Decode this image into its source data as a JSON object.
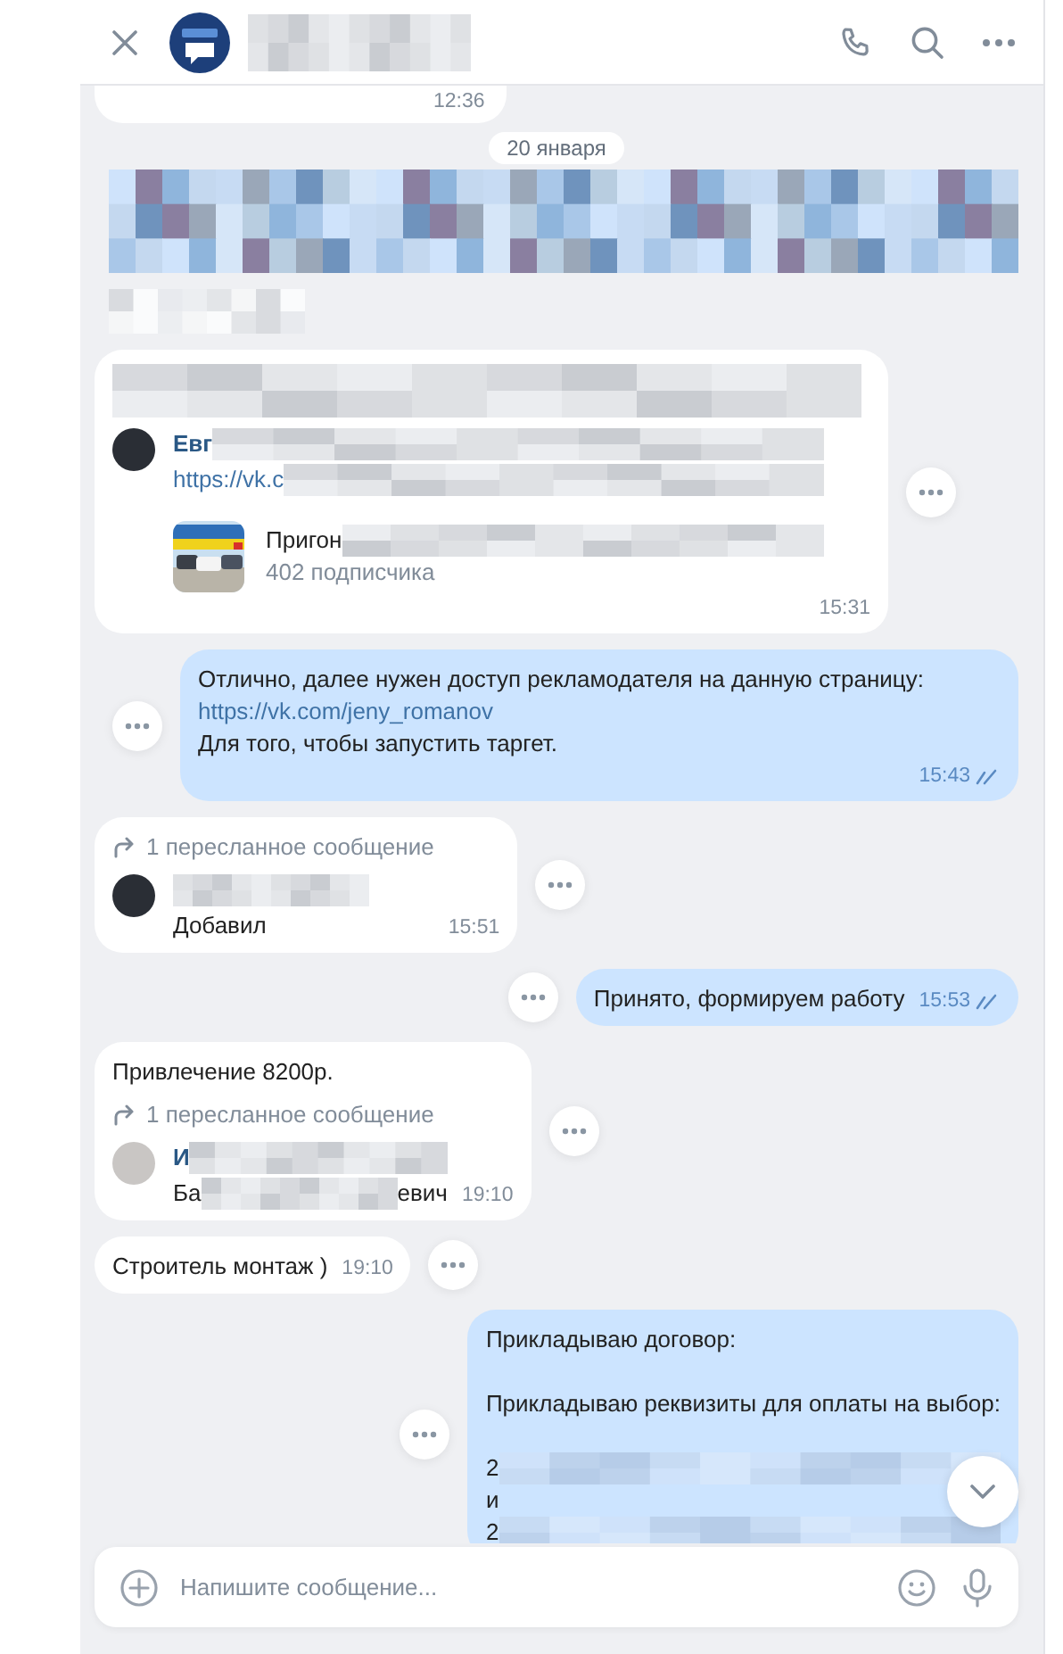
{
  "messages": [
    {
      "kind": "cut",
      "time": "12:36"
    },
    {
      "kind": "date",
      "text": "20 января"
    },
    {
      "kind": "redacted_outgoing"
    },
    {
      "kind": "redacted_incoming"
    },
    {
      "kind": "incoming",
      "blocks": [
        [
          [
            {
              "kind": "redacted"
            }
          ]
        ]
      ],
      "forward": {
        "author": [
          {
            "kind": "text",
            "text": "Евг"
          },
          {
            "kind": "redacted"
          }
        ],
        "avatar": {
          "color": "#2a2e35"
        },
        "lines": [
          [
            {
              "kind": "link",
              "text": "https://vk.c"
            },
            {
              "kind": "redacted"
            }
          ]
        ],
        "card": {
          "title": [
            {
              "kind": "text",
              "text": "Пригон"
            },
            {
              "kind": "redacted"
            }
          ],
          "subtitle": "402 подписчика"
        }
      },
      "time": "15:31"
    },
    {
      "kind": "outgoing",
      "blocks": [
        [
          [
            {
              "kind": "text",
              "text": "Отлично, далее нужен доступ рекламодателя на данную страницу:"
            }
          ],
          [
            {
              "kind": "link",
              "text": "https://vk.com/jeny_romanov"
            }
          ],
          [
            {
              "kind": "text",
              "text": "Для того, чтобы запустить таргет."
            }
          ]
        ]
      ],
      "time": "15:43",
      "read": true
    },
    {
      "kind": "incoming",
      "forward": {
        "header": "1 пересланное сообщение",
        "author": [
          {
            "kind": "redacted"
          }
        ],
        "avatar": {
          "color": "#2a2e35"
        },
        "lines": [
          [
            {
              "kind": "text",
              "text": "Добавил"
            }
          ]
        ]
      },
      "time": "15:51"
    },
    {
      "kind": "outgoing",
      "blocks": [
        [
          [
            {
              "kind": "text",
              "text": "Принято, формируем работу"
            }
          ]
        ]
      ],
      "time": "15:53",
      "read": true
    },
    {
      "kind": "incoming",
      "blocks": [
        [
          [
            {
              "kind": "text",
              "text": "Привлечение 8200р."
            }
          ]
        ]
      ],
      "forward": {
        "header": "1 пересланное сообщение",
        "author": [
          {
            "kind": "text",
            "text": "И"
          },
          {
            "kind": "redacted"
          }
        ],
        "avatar": {
          "color": "#c9c6c4"
        },
        "lines": [
          [
            {
              "kind": "text",
              "text": "Ба"
            },
            {
              "kind": "redacted"
            },
            {
              "kind": "text",
              "text": "евич"
            }
          ]
        ]
      },
      "time": "19:10"
    },
    {
      "kind": "incoming",
      "blocks": [
        [
          [
            {
              "kind": "text",
              "text": "Строитель монтаж )"
            }
          ]
        ]
      ],
      "time": "19:10"
    },
    {
      "kind": "outgoing",
      "blocks": [
        [
          [
            {
              "kind": "text",
              "text": "Прикладываю договор:"
            }
          ]
        ],
        [
          [
            {
              "kind": "text",
              "text": "Прикладываю реквизиты для оплаты на выбор:"
            }
          ]
        ],
        [
          [
            {
              "kind": "text",
              "text": "2"
            },
            {
              "kind": "redacted"
            }
          ],
          [
            {
              "kind": "text",
              "text": "и"
            }
          ],
          [
            {
              "kind": "text",
              "text": "2"
            },
            {
              "kind": "redacted"
            }
          ]
        ]
      ]
    }
  ],
  "composer": {
    "placeholder": "Напишите сообщение..."
  }
}
